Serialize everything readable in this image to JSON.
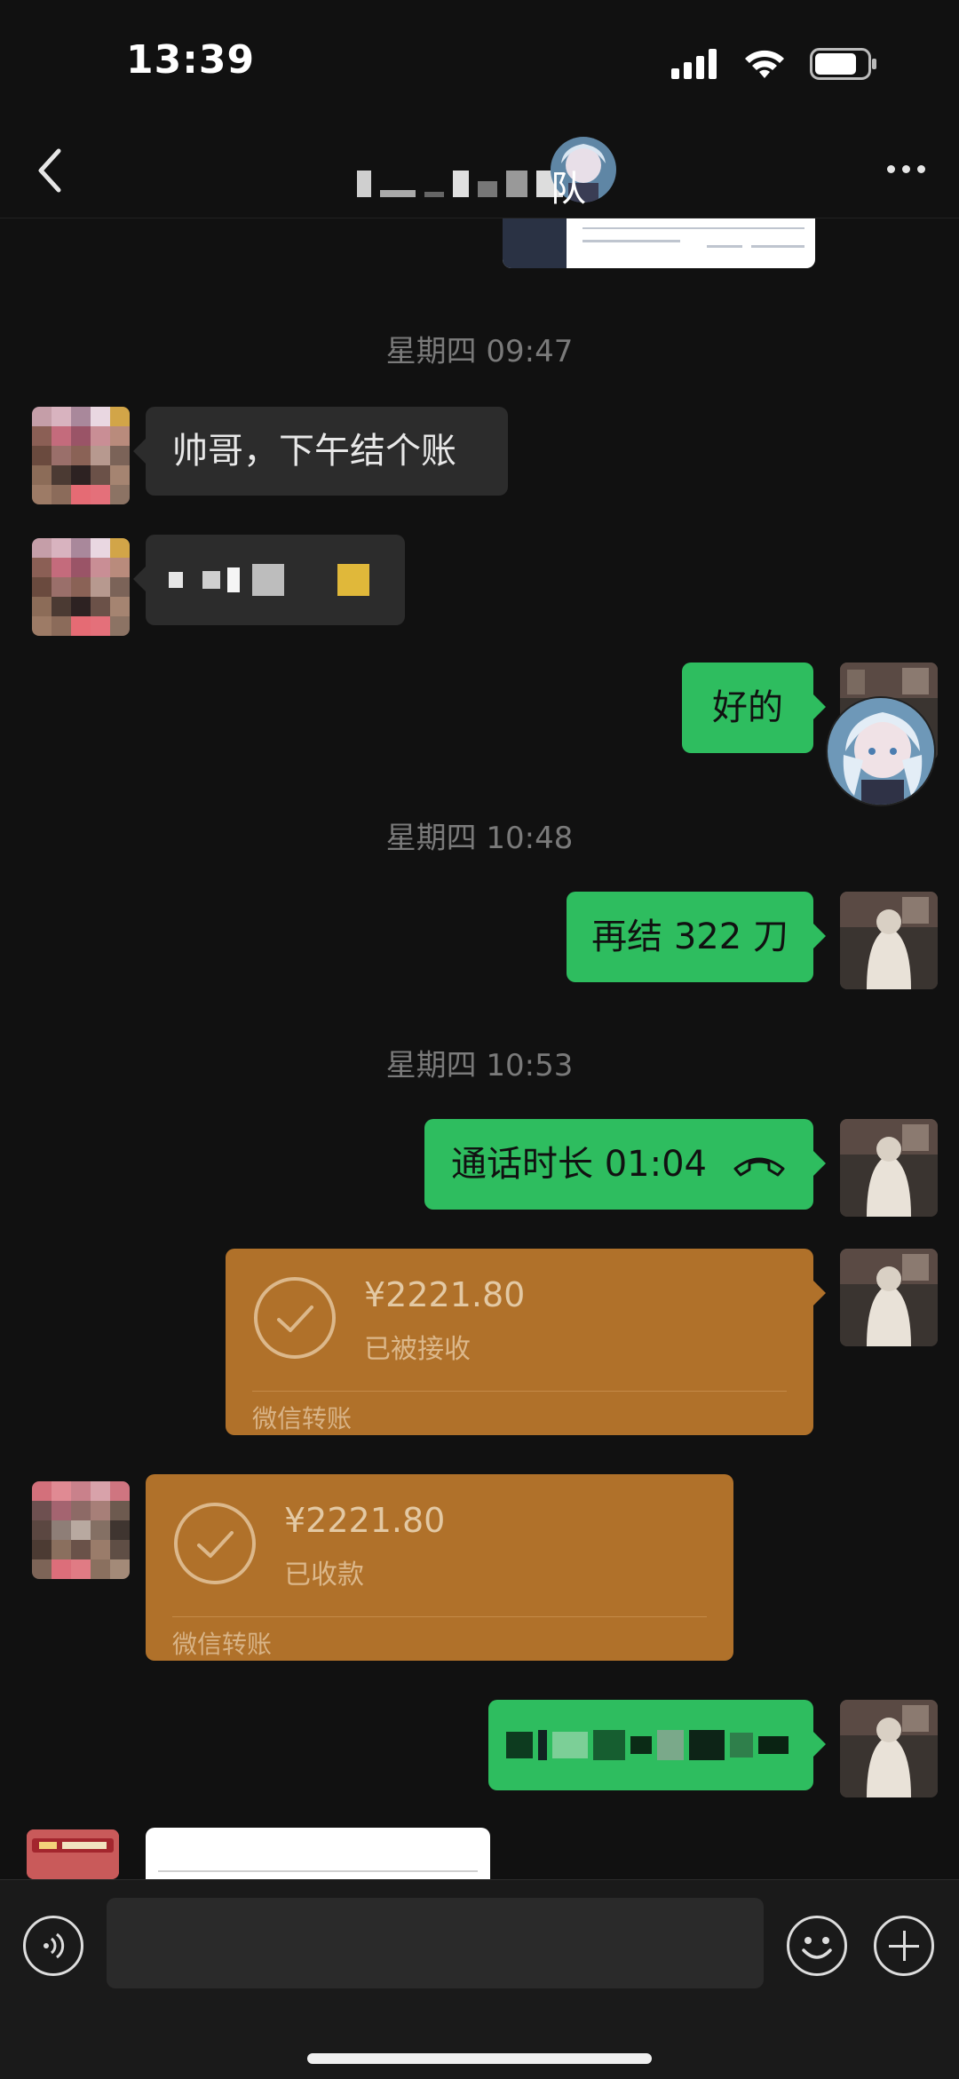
{
  "status_bar": {
    "time": "13:39",
    "icons": [
      "cellular-signal-icon",
      "wifi-icon",
      "battery-icon"
    ]
  },
  "nav": {
    "title_visible_suffix": "队",
    "back_icon": "chevron-left-icon",
    "more_icon": "more-dots-icon"
  },
  "messages": {
    "ts1": "星期四 09:47",
    "m1": "帅哥，下午结个账",
    "m3": "好的",
    "ts2": "星期四 10:48",
    "m4": "再结 322 刀",
    "ts3": "星期四 10:53",
    "m5_prefix": "通话时长 01:04",
    "call_icon": "phone-hangup-icon",
    "transfer1": {
      "amount": "¥2221.80",
      "status": "已被接收",
      "label": "微信转账"
    },
    "transfer2": {
      "amount": "¥2221.80",
      "status": "已收款",
      "label": "微信转账"
    }
  },
  "colors": {
    "background": "#111111",
    "bubble_self": "#2ebd5f",
    "bubble_other": "#2c2c2c",
    "transfer_card": "#b0712a",
    "timestamp": "#7a7a7a"
  },
  "input_bar": {
    "placeholder": "",
    "voice_icon": "voice-icon",
    "emoji_icon": "emoji-icon",
    "plus_icon": "plus-icon"
  }
}
